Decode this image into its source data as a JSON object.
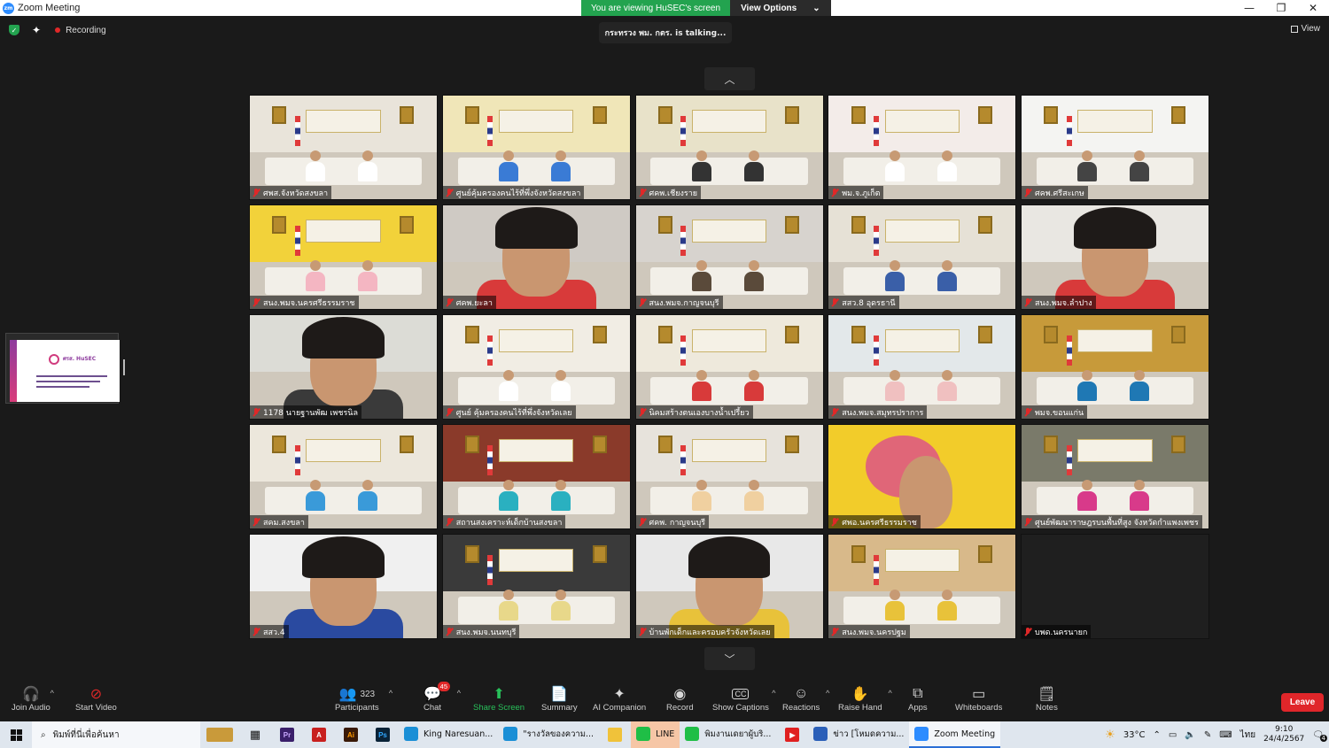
{
  "window": {
    "title": "Zoom Meeting",
    "logo_text": "zm"
  },
  "share_banner": {
    "viewing": "You are viewing HuSEC's screen",
    "view_options": "View Options"
  },
  "window_controls": {
    "minimize": "—",
    "restore": "❐",
    "close": "✕"
  },
  "top_bar": {
    "recording": "Recording",
    "view": "View"
  },
  "talking": "กระทรวง พม. กตร. is talking...",
  "share_thumb": {
    "title": "ศรส. HuSEC"
  },
  "tiles": [
    {
      "name": "ศพส.จังหวัดสงขลา",
      "scene": "office",
      "wall": "#e9e4da",
      "accent": "#ffffff"
    },
    {
      "name": "ศูนย์คุ้มครองคนไร้ที่พึ่งจังหวัดสงขลา",
      "scene": "office",
      "wall": "#f0e6b8",
      "accent": "#3a7bd5"
    },
    {
      "name": "ศคพ.เชียงราย",
      "scene": "office",
      "wall": "#e8e2c9",
      "accent": "#333333"
    },
    {
      "name": "พม.จ.ภูเก็ต",
      "scene": "office",
      "wall": "#f3ece9",
      "accent": "#ffffff"
    },
    {
      "name": "ศคพ.ศรีสะเกษ",
      "scene": "office",
      "wall": "#f4f4f2",
      "accent": "#444444"
    },
    {
      "name": "สนง.พมจ.นครศรีธรรมราช",
      "scene": "office",
      "wall": "#f2d23a",
      "accent": "#f4b6c2"
    },
    {
      "name": "ศคพ.ยะลา",
      "scene": "closeup",
      "wall": "#cfcac4",
      "accent": "#d83a3a"
    },
    {
      "name": "สนง.พมจ.กาญจนบุรี",
      "scene": "office",
      "wall": "#d7d3ce",
      "accent": "#5a4a3a"
    },
    {
      "name": "สสว.8 อุดรธานี",
      "scene": "office",
      "wall": "#e6e1d6",
      "accent": "#3a5fa8"
    },
    {
      "name": "สนง.พมจ.ลำปาง",
      "scene": "closeup",
      "wall": "#e9e7e2",
      "accent": "#d83a3a"
    },
    {
      "name": "1178 นายฐานพัฒ เพชรนิล",
      "scene": "closeup",
      "wall": "#dcdcd6",
      "accent": "#3a3a3a"
    },
    {
      "name": "ศูนย์ คุ้มครองคนไร้ที่พึ่งจังหวัดเลย",
      "scene": "office",
      "wall": "#f1ede4",
      "accent": "#ffffff"
    },
    {
      "name": "นิคมสร้างตนเองบางน้ำเปรี้ยว",
      "scene": "office",
      "wall": "#eee9dc",
      "accent": "#d83a3a"
    },
    {
      "name": "สนง.พมจ.สมุทรปราการ",
      "scene": "office",
      "wall": "#e3e8ea",
      "accent": "#f0c0c0"
    },
    {
      "name": "พมจ.ขอนแก่น",
      "scene": "office",
      "wall": "#c79a3a",
      "accent": "#1f78b4"
    },
    {
      "name": "สคม.สงขลา",
      "scene": "office",
      "wall": "#ece7dc",
      "accent": "#3a9ad9"
    },
    {
      "name": "สถานสงเคราะห์เด็กบ้านสงขลา",
      "scene": "office",
      "wall": "#8a3a2a",
      "accent": "#2ab0c0"
    },
    {
      "name": "ศคพ. กาญจนบุรี",
      "scene": "office",
      "wall": "#e7e3dc",
      "accent": "#f0d0a0"
    },
    {
      "name": "ศพอ.นครศรีธรรมราช",
      "scene": "poster",
      "wall": "#f2cc2a",
      "accent": "#d83a9a"
    },
    {
      "name": "ศูนย์พัฒนาราษฎรบนพื้นที่สูง จังหวัดกำแพงเพชร",
      "scene": "office",
      "wall": "#7a7a6a",
      "accent": "#d83a8a"
    },
    {
      "name": "สสว.4",
      "scene": "closeup",
      "wall": "#f0f0f0",
      "accent": "#2a4aa0"
    },
    {
      "name": "สนง.พมจ.นนทบุรี",
      "scene": "office",
      "wall": "#3a3a3a",
      "accent": "#e8d88a"
    },
    {
      "name": "บ้านพักเด็กและครอบครัวจังหวัดเลย",
      "scene": "closeup",
      "wall": "#e8e8e8",
      "accent": "#e8c23a"
    },
    {
      "name": "สนง.พมจ.นครปฐม",
      "scene": "office",
      "wall": "#d8b98a",
      "accent": "#e8c23a"
    },
    {
      "name": "บพด.นครนายก",
      "scene": "empty",
      "wall": "#1f1f1f",
      "accent": "#1f1f1f"
    }
  ],
  "toolbar": {
    "join_audio": "Join Audio",
    "start_video": "Start Video",
    "participants": "Participants",
    "participants_count": "323",
    "chat": "Chat",
    "chat_badge": "45",
    "share_screen": "Share Screen",
    "summary": "Summary",
    "ai_companion": "AI Companion",
    "record": "Record",
    "show_captions": "Show Captions",
    "reactions": "Reactions",
    "raise_hand": "Raise Hand",
    "apps": "Apps",
    "whiteboards": "Whiteboards",
    "notes": "Notes",
    "leave": "Leave"
  },
  "taskbar": {
    "search_placeholder": "พิมพ์ที่นี่เพื่อค้นหา",
    "apps": [
      {
        "label": "King Naresuan...",
        "icon": "edge-icon",
        "color": "#1a8fd6"
      },
      {
        "label": "\"รางวัลของความ...",
        "icon": "edge-icon",
        "color": "#1a8fd6"
      },
      {
        "label": "LINE",
        "icon": "line-icon",
        "color": "#1fbe46"
      },
      {
        "label": "พิมงานเดยาผู้บริ...",
        "icon": "line-icon",
        "color": "#1fbe46"
      },
      {
        "label": "ข่าว [โหมดความ...",
        "icon": "word-icon",
        "color": "#2b5fb8"
      },
      {
        "label": "Zoom Meeting",
        "icon": "zoom-icon",
        "color": "#2d8cff"
      }
    ],
    "temperature": "33°C",
    "language": "ไทย",
    "time": "9:10",
    "date": "24/4/2567",
    "notification_count": "4"
  },
  "colors": {
    "share_green": "#23a34f",
    "leave_red": "#e0262a",
    "zoom_blue": "#2d8cff"
  }
}
